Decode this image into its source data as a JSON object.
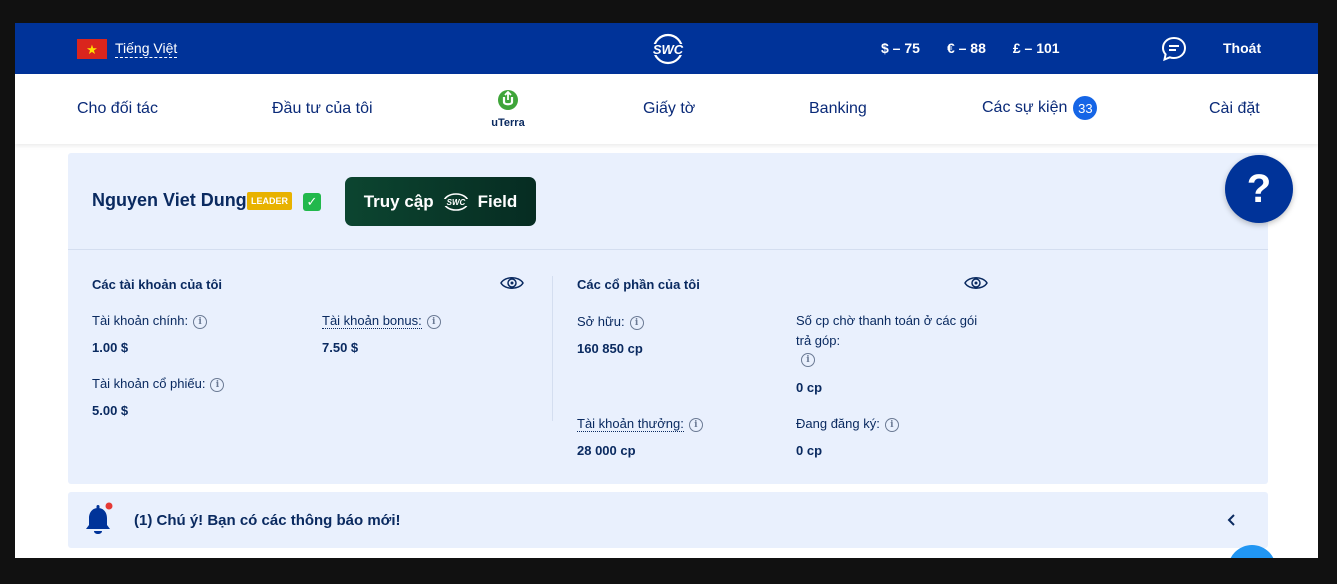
{
  "topbar": {
    "language": "Tiếng Việt",
    "brand": "SWC",
    "rates": [
      "$ – 75",
      "€ – 88",
      "£ – 101"
    ],
    "logout": "Thoát"
  },
  "nav": {
    "items": [
      "Cho đối tác",
      "Đầu tư của tôi",
      "Giấy tờ",
      "Banking",
      "Các sự kiện",
      "Cài đặt"
    ],
    "events_count": "33",
    "uterra": "uTerra"
  },
  "profile": {
    "name": "Nguyen Viet Dung",
    "badge": "LEADER",
    "field_button_prefix": "Truy cập",
    "field_button_logo": "SWC",
    "field_button_suffix": "Field"
  },
  "accounts": {
    "title": "Các tài khoản của tôi",
    "main_label": "Tài khoản chính:",
    "main_value": "1.00 $",
    "bonus_label": "Tài khoản bonus:",
    "bonus_value": "7.50 $",
    "stock_label": "Tài khoản cổ phiếu:",
    "stock_value": "5.00 $"
  },
  "shares": {
    "title": "Các cổ phần của tôi",
    "own_label": "Sở hữu:",
    "own_value": "160 850 cp",
    "pending_label_1": "Số cp chờ thanh toán ở các gói",
    "pending_label_2": "trả góp:",
    "pending_value": "0  cp",
    "reward_label": "Tài khoản thưởng:",
    "reward_value": "28 000 cp",
    "registering_label": "Đang đăng ký:",
    "registering_value": "0  cp"
  },
  "notice": {
    "text": "(1) Chú ý! Bạn có các thông báo mới!"
  },
  "help": {
    "label": "?"
  },
  "colors": {
    "primary": "#003399",
    "panel": "#e9f0fd",
    "leader": "#e8b200",
    "field": "#0c4530"
  }
}
